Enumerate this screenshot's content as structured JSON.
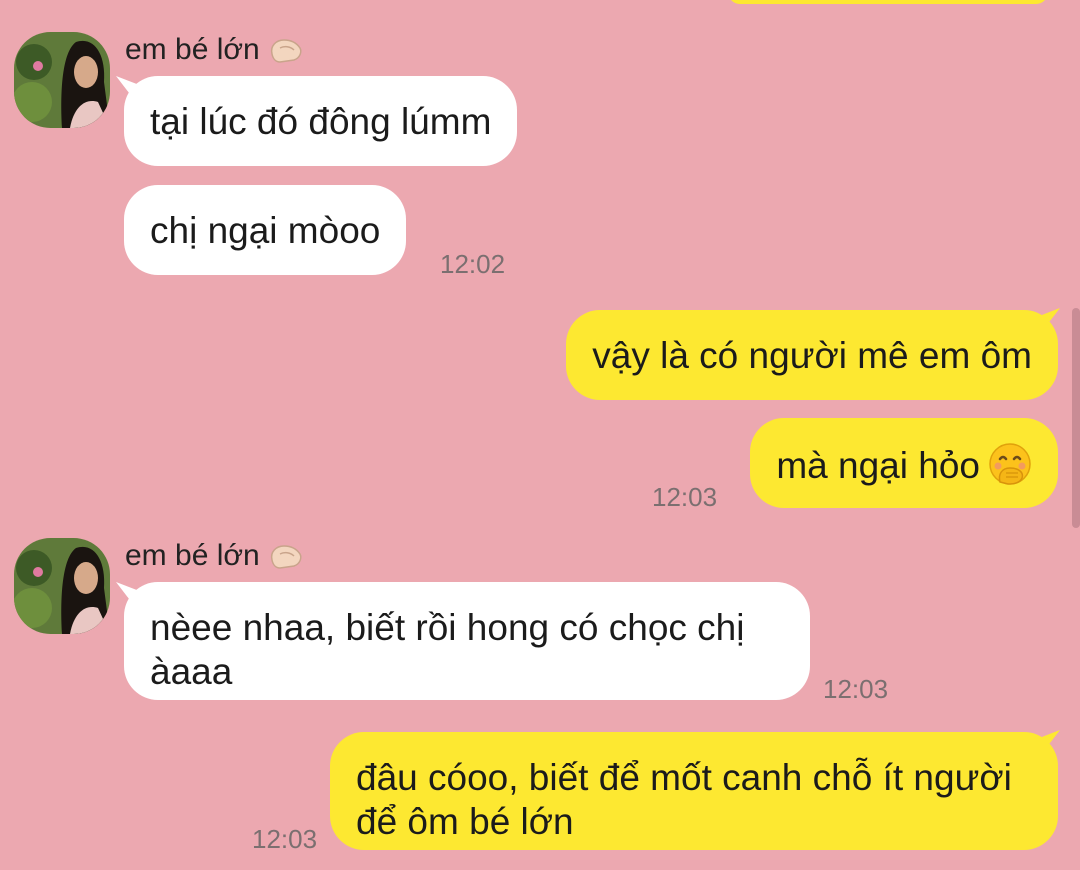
{
  "chat": {
    "colors": {
      "background": "#eca8b0",
      "incoming_bubble": "#ffffff",
      "outgoing_bubble": "#fde831",
      "timestamp": "#7b6f70"
    },
    "groups": [
      {
        "sender": "em bé lớn",
        "sender_icon": "pinched-fingers-icon",
        "messages": [
          "tại lúc đó đông lúmm",
          "chị ngại mòoo"
        ],
        "time": "12:02"
      },
      {
        "outgoing": true,
        "messages": [
          "vậy là có người mê em ôm",
          "mà ngại hỏo"
        ],
        "emoji": "face-with-hand-over-mouth-icon",
        "time": "12:03"
      },
      {
        "sender": "em bé lớn",
        "sender_icon": "pinched-fingers-icon",
        "messages": [
          "nèee nhaa, biết rồi hong có chọc chị àaaa"
        ],
        "time": "12:03"
      },
      {
        "outgoing": true,
        "messages": [
          "đâu cóoo, biết để mốt canh chỗ ít người để ôm bé lớn"
        ],
        "time": "12:03"
      }
    ]
  }
}
